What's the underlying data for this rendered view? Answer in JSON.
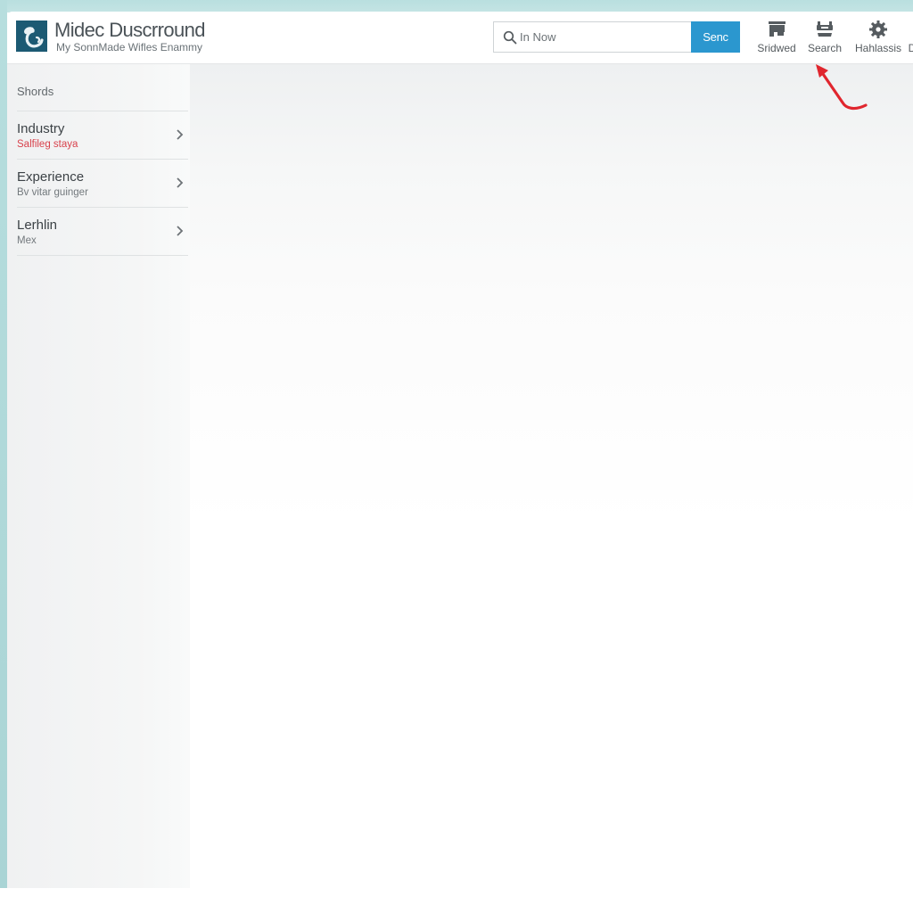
{
  "header": {
    "brand_title": "Midec Duscrround",
    "brand_subtitle": "My SonnMade Wifles Enammy",
    "search": {
      "placeholder": "In Now",
      "value": "",
      "button_label": "Senc"
    },
    "tools": [
      {
        "label": "Sridwed",
        "icon": "bookmark-box-icon"
      },
      {
        "label": "Search",
        "icon": "toolbox-icon"
      },
      {
        "label": "Hahlassis",
        "icon": "gear-icon"
      },
      {
        "label": "D",
        "icon": "more-icon"
      }
    ]
  },
  "sidebar": {
    "heading": "Shords",
    "items": [
      {
        "title": "Industry",
        "subtitle": "Salfileg staya",
        "subtitle_color": "#d8424c"
      },
      {
        "title": "Experience",
        "subtitle": "Bv vitar guinger"
      },
      {
        "title": "Lerhlin",
        "subtitle": "Mex"
      }
    ]
  },
  "annotation": {
    "type": "red-arrow",
    "points_to": "Search",
    "color": "#e0262e"
  },
  "colors": {
    "accent": "#2b97cf",
    "logo": "#1c5a73",
    "backdrop": "#b9dfdf"
  }
}
